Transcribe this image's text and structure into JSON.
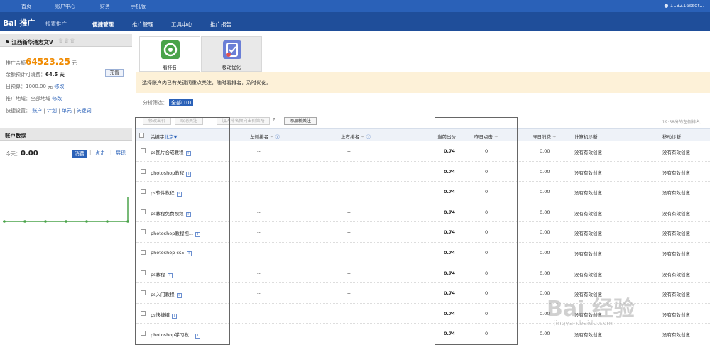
{
  "topbar": {
    "links": [
      "首页",
      "账户中心",
      "财务",
      "手机版"
    ],
    "user": "113Z16ssqt..."
  },
  "brand": {
    "logo": "Bai 推广",
    "sub": "搜索推广"
  },
  "nav": {
    "tabs": [
      {
        "label": "便捷管理",
        "active": true
      },
      {
        "label": "推广管理",
        "active": false
      },
      {
        "label": "工具中心",
        "active": false
      },
      {
        "label": "推广报告",
        "active": false
      }
    ]
  },
  "account": {
    "name": "江西新华涌志文V",
    "balance_label": "推广余额",
    "balance": "64523.25",
    "balance_unit": "元",
    "days_label": "余额预计可消费：",
    "days": "64.5 天",
    "recharge": "充值",
    "budget_label": "日预算：",
    "budget": "1000.00 元",
    "budget_edit": "修改",
    "region_label": "推广地域：",
    "region": "全部地域",
    "region_edit": "修改",
    "quick_label": "快捷设置：",
    "quick": [
      "账户",
      "计划",
      "单元",
      "关键词"
    ]
  },
  "account_data": {
    "title": "账户数据",
    "today_label": "今天：",
    "today_value": "0.00",
    "metrics": [
      "消费",
      "点击",
      "展现"
    ]
  },
  "tools": [
    {
      "label": "看排名",
      "color": "#4aa34a"
    },
    {
      "label": "移动优化",
      "color": "#6b7fd6"
    }
  ],
  "notice": "选择账户内已有关键词重点关注，随时看排名，及时优化。",
  "filter": {
    "label": "分析筛选：",
    "all": "全部(10)"
  },
  "toolbar": {
    "modify_bid": "修改出价",
    "cancel_follow": "取消关注",
    "bid_strategy": "加入排名倾向出价策略",
    "help": "?",
    "add_follow": "添加新关注",
    "refresh_note": "19:58分的左侧排名，"
  },
  "table": {
    "headers": {
      "keyword": "关键字",
      "region": "北京▼",
      "left_rank": "左侧排名",
      "top_rank": "上方排名",
      "bid": "当前出价",
      "yesterday_clicks": "昨日点击",
      "yesterday_cost": "昨日消费",
      "pc_diag": "计算机诊断",
      "mobile_diag": "移动诊断"
    },
    "rows": [
      {
        "keyword": "ps图片合成教程",
        "left": "--",
        "top": "--",
        "bid": "0.74",
        "clicks": "0",
        "cost": "0.00",
        "pc": "没有有效创意",
        "mobile": "没有有效创意"
      },
      {
        "keyword": "photoshop教程",
        "left": "--",
        "top": "--",
        "bid": "0.74",
        "clicks": "0",
        "cost": "0.00",
        "pc": "没有有效创意",
        "mobile": "没有有效创意"
      },
      {
        "keyword": "ps软件教程",
        "left": "--",
        "top": "--",
        "bid": "0.74",
        "clicks": "0",
        "cost": "0.00",
        "pc": "没有有效创意",
        "mobile": "没有有效创意"
      },
      {
        "keyword": "ps教程免费视频",
        "left": "--",
        "top": "--",
        "bid": "0.74",
        "clicks": "0",
        "cost": "0.00",
        "pc": "没有有效创意",
        "mobile": "没有有效创意"
      },
      {
        "keyword": "photoshop教程视...",
        "left": "--",
        "top": "--",
        "bid": "0.74",
        "clicks": "0",
        "cost": "0.00",
        "pc": "没有有效创意",
        "mobile": "没有有效创意"
      },
      {
        "keyword": "photoshop cs5",
        "left": "--",
        "top": "--",
        "bid": "0.74",
        "clicks": "0",
        "cost": "0.00",
        "pc": "没有有效创意",
        "mobile": "没有有效创意"
      },
      {
        "keyword": "ps教程",
        "left": "--",
        "top": "--",
        "bid": "0.74",
        "clicks": "0",
        "cost": "0.00",
        "pc": "没有有效创意",
        "mobile": "没有有效创意"
      },
      {
        "keyword": "ps入门教程",
        "left": "--",
        "top": "--",
        "bid": "0.74",
        "clicks": "0",
        "cost": "0.00",
        "pc": "没有有效创意",
        "mobile": "没有有效创意"
      },
      {
        "keyword": "ps快捷键",
        "left": "--",
        "top": "--",
        "bid": "0.74",
        "clicks": "0",
        "cost": "0.00",
        "pc": "没有有效创意",
        "mobile": "没有有效创意"
      },
      {
        "keyword": "photoshop学习教...",
        "left": "--",
        "top": "--",
        "bid": "0.74",
        "clicks": "0",
        "cost": "0.00",
        "pc": "没有有效创意",
        "mobile": "没有有效创意"
      }
    ]
  },
  "watermark": {
    "main": "Bai 经验",
    "url": "jingyan.baidu.com"
  }
}
